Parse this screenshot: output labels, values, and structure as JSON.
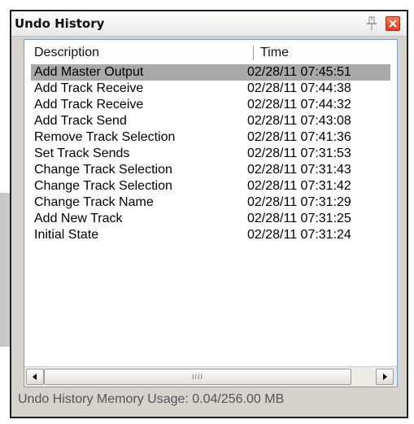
{
  "window": {
    "title": "Undo History",
    "pin_icon": "pin-icon",
    "close_icon": "close-icon"
  },
  "columns": {
    "description": "Description",
    "time": "Time"
  },
  "rows": [
    {
      "description": "Add Master Output",
      "time": "02/28/11 07:45:51",
      "selected": true
    },
    {
      "description": "Add Track Receive",
      "time": "02/28/11 07:44:38"
    },
    {
      "description": "Add Track Receive",
      "time": "02/28/11 07:44:32"
    },
    {
      "description": "Add Track Send",
      "time": "02/28/11 07:43:08"
    },
    {
      "description": "Remove Track Selection",
      "time": "02/28/11 07:41:36"
    },
    {
      "description": "Set Track Sends",
      "time": "02/28/11 07:31:53"
    },
    {
      "description": "Change Track Selection",
      "time": "02/28/11 07:31:43"
    },
    {
      "description": "Change Track Selection",
      "time": "02/28/11 07:31:42"
    },
    {
      "description": "Change Track Name",
      "time": "02/28/11 07:31:29"
    },
    {
      "description": "Add New Track",
      "time": "02/28/11 07:31:25"
    },
    {
      "description": "Initial State",
      "time": "02/28/11 07:31:24"
    }
  ],
  "scrollbar": {
    "left_icon": "arrow-left-icon",
    "right_icon": "arrow-right-icon",
    "thumb_grip": "IIII"
  },
  "status": {
    "text": "Undo History Memory Usage: 0.04/256.00 MB"
  },
  "colors": {
    "selected_row": "#a9a9a9",
    "close_button": "#e0391e",
    "window_frame": "#d6d3ce"
  }
}
